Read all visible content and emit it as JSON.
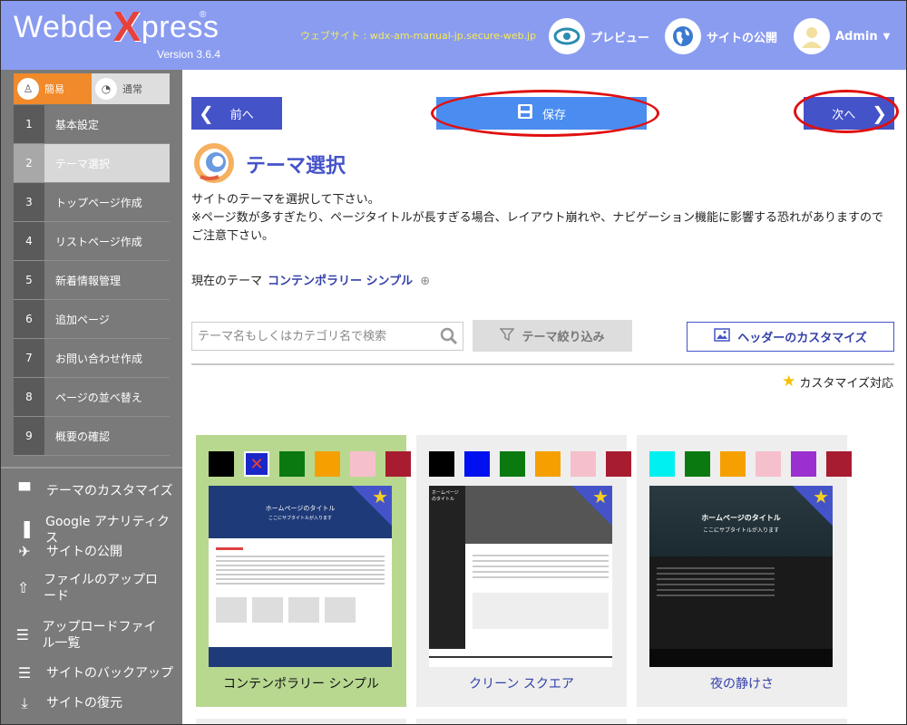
{
  "app": {
    "name_pre": "Webde",
    "name_x": "X",
    "name_post": "press",
    "registered": "®",
    "version": "Version 3.6.4"
  },
  "header": {
    "site_url": "ウェブサイト : wdx-am-manual-jp.secure-web.jp",
    "preview": "プレビュー",
    "publish": "サイトの公開",
    "user": "Admin"
  },
  "modes": {
    "easy": "簡易",
    "normal": "通常"
  },
  "steps": [
    {
      "num": "1",
      "label": "基本設定"
    },
    {
      "num": "2",
      "label": "テーマ選択"
    },
    {
      "num": "3",
      "label": "トップページ作成"
    },
    {
      "num": "4",
      "label": "リストページ作成"
    },
    {
      "num": "5",
      "label": "新着情報管理"
    },
    {
      "num": "6",
      "label": "追加ページ"
    },
    {
      "num": "7",
      "label": "お問い合わせ作成"
    },
    {
      "num": "8",
      "label": "ページの並べ替え"
    },
    {
      "num": "9",
      "label": "概要の確認"
    }
  ],
  "tools": [
    {
      "label": "テーマのカスタマイズ",
      "icon": "paint-roller-icon"
    },
    {
      "label": "Google アナリティクス",
      "icon": "analytics-icon"
    },
    {
      "label": "サイトの公開",
      "icon": "rocket-icon"
    },
    {
      "label": "ファイルのアップロード",
      "icon": "upload-icon"
    },
    {
      "label": "アップロードファイル一覧",
      "icon": "list-icon"
    },
    {
      "label": "サイトのバックアップ",
      "icon": "backup-icon"
    },
    {
      "label": "サイトの復元",
      "icon": "restore-icon"
    }
  ],
  "toolbar": {
    "prev": "前へ",
    "save": "保存",
    "next": "次へ"
  },
  "page": {
    "title": "テーマ選択",
    "desc1": "サイトのテーマを選択して下さい。",
    "desc2": "※ページ数が多すぎたり、ページタイトルが長すぎる場合、レイアウト崩れや、ナビゲーション機能に影響する恐れがありますので",
    "desc3": "ご注意下さい。",
    "current_label": "現在のテーマ",
    "current_value": "コンテンポラリー シンプル",
    "search_placeholder": "テーマ名もしくはカテゴリ名で検索",
    "filter": "テーマ絞り込み",
    "header_customize": "ヘッダーのカスタマイズ",
    "customizable": "カスタマイズ対応"
  },
  "themes": [
    {
      "name": "コンテンポラリー シンプル",
      "colors": [
        "#000000",
        "#1a28c8",
        "#0a7a10",
        "#f5a000",
        "#f5c0cc",
        "#a81c30"
      ],
      "thumb_title": "ホームページのタイトル",
      "thumb_sub": "ここにサブタイトルが入ります"
    },
    {
      "name": "クリーン スクエア",
      "colors": [
        "#000000",
        "#0010f0",
        "#0a7a10",
        "#f5a000",
        "#f5c0cc",
        "#a81c30"
      ],
      "thumb_title": "ホームページのタイトル",
      "thumb_sub": ""
    },
    {
      "name": "夜の静けさ",
      "colors": [
        "#00f0f0",
        "#0a7a10",
        "#f5a000",
        "#f5c0cc",
        "#9a30d0",
        "#a81c30"
      ],
      "thumb_title": "ホームページのタイトル",
      "thumb_sub": "ここにサブタイトルが入ります"
    }
  ],
  "colors": {
    "header_bg": "#8a9cf0",
    "accent": "#4553c9",
    "save": "#4a8cf0",
    "easy": "#f08a2a",
    "selected_card": "#b8d890"
  }
}
